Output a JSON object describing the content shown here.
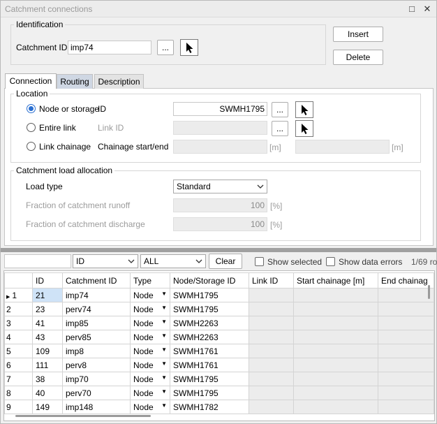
{
  "window": {
    "title": "Catchment connections",
    "minimize_glyph": "□",
    "close_glyph": "✕"
  },
  "identification": {
    "group_label": "Identification",
    "catchment_id_label": "Catchment ID",
    "catchment_id_value": "imp74",
    "browse_label": "...",
    "insert_label": "Insert",
    "delete_label": "Delete"
  },
  "tabs": [
    {
      "label": "Connection"
    },
    {
      "label": "Routing"
    },
    {
      "label": "Description"
    }
  ],
  "location": {
    "group_label": "Location",
    "node_or_storage_label": "Node or storage",
    "id_label": "ID",
    "id_value": "SWMH1795",
    "entire_link_label": "Entire link",
    "link_id_label": "Link ID",
    "link_id_value": "",
    "link_chainage_label": "Link chainage",
    "chainage_label": "Chainage start/end",
    "unit_m": "[m]",
    "browse_label": "..."
  },
  "load": {
    "group_label": "Catchment load allocation",
    "load_type_label": "Load type",
    "load_type_value": "Standard",
    "runoff_label": "Fraction of catchment runoff",
    "runoff_value": "100",
    "discharge_label": "Fraction of catchment discharge",
    "discharge_value": "100",
    "unit_pct": "[%]"
  },
  "filter": {
    "search_value": "",
    "field_select": "ID",
    "scope_select": "ALL",
    "clear_label": "Clear",
    "show_selected_label": "Show selected",
    "show_errors_label": "Show data errors",
    "count": "1/69 ro"
  },
  "grid": {
    "columns": [
      "",
      "ID",
      "Catchment ID",
      "Type",
      "Node/Storage ID",
      "Link ID",
      "Start chainage [m]",
      "End chainag"
    ],
    "rows": [
      {
        "n": "1",
        "id": "21",
        "catch": "imp74",
        "type": "Node",
        "node": "SWMH1795"
      },
      {
        "n": "2",
        "id": "23",
        "catch": "perv74",
        "type": "Node",
        "node": "SWMH1795"
      },
      {
        "n": "3",
        "id": "41",
        "catch": "imp85",
        "type": "Node",
        "node": "SWMH2263"
      },
      {
        "n": "4",
        "id": "43",
        "catch": "perv85",
        "type": "Node",
        "node": "SWMH2263"
      },
      {
        "n": "5",
        "id": "109",
        "catch": "imp8",
        "type": "Node",
        "node": "SWMH1761"
      },
      {
        "n": "6",
        "id": "111",
        "catch": "perv8",
        "type": "Node",
        "node": "SWMH1761"
      },
      {
        "n": "7",
        "id": "38",
        "catch": "imp70",
        "type": "Node",
        "node": "SWMH1795"
      },
      {
        "n": "8",
        "id": "40",
        "catch": "perv70",
        "type": "Node",
        "node": "SWMH1795"
      },
      {
        "n": "9",
        "id": "149",
        "catch": "imp148",
        "type": "Node",
        "node": "SWMH1782"
      }
    ]
  }
}
